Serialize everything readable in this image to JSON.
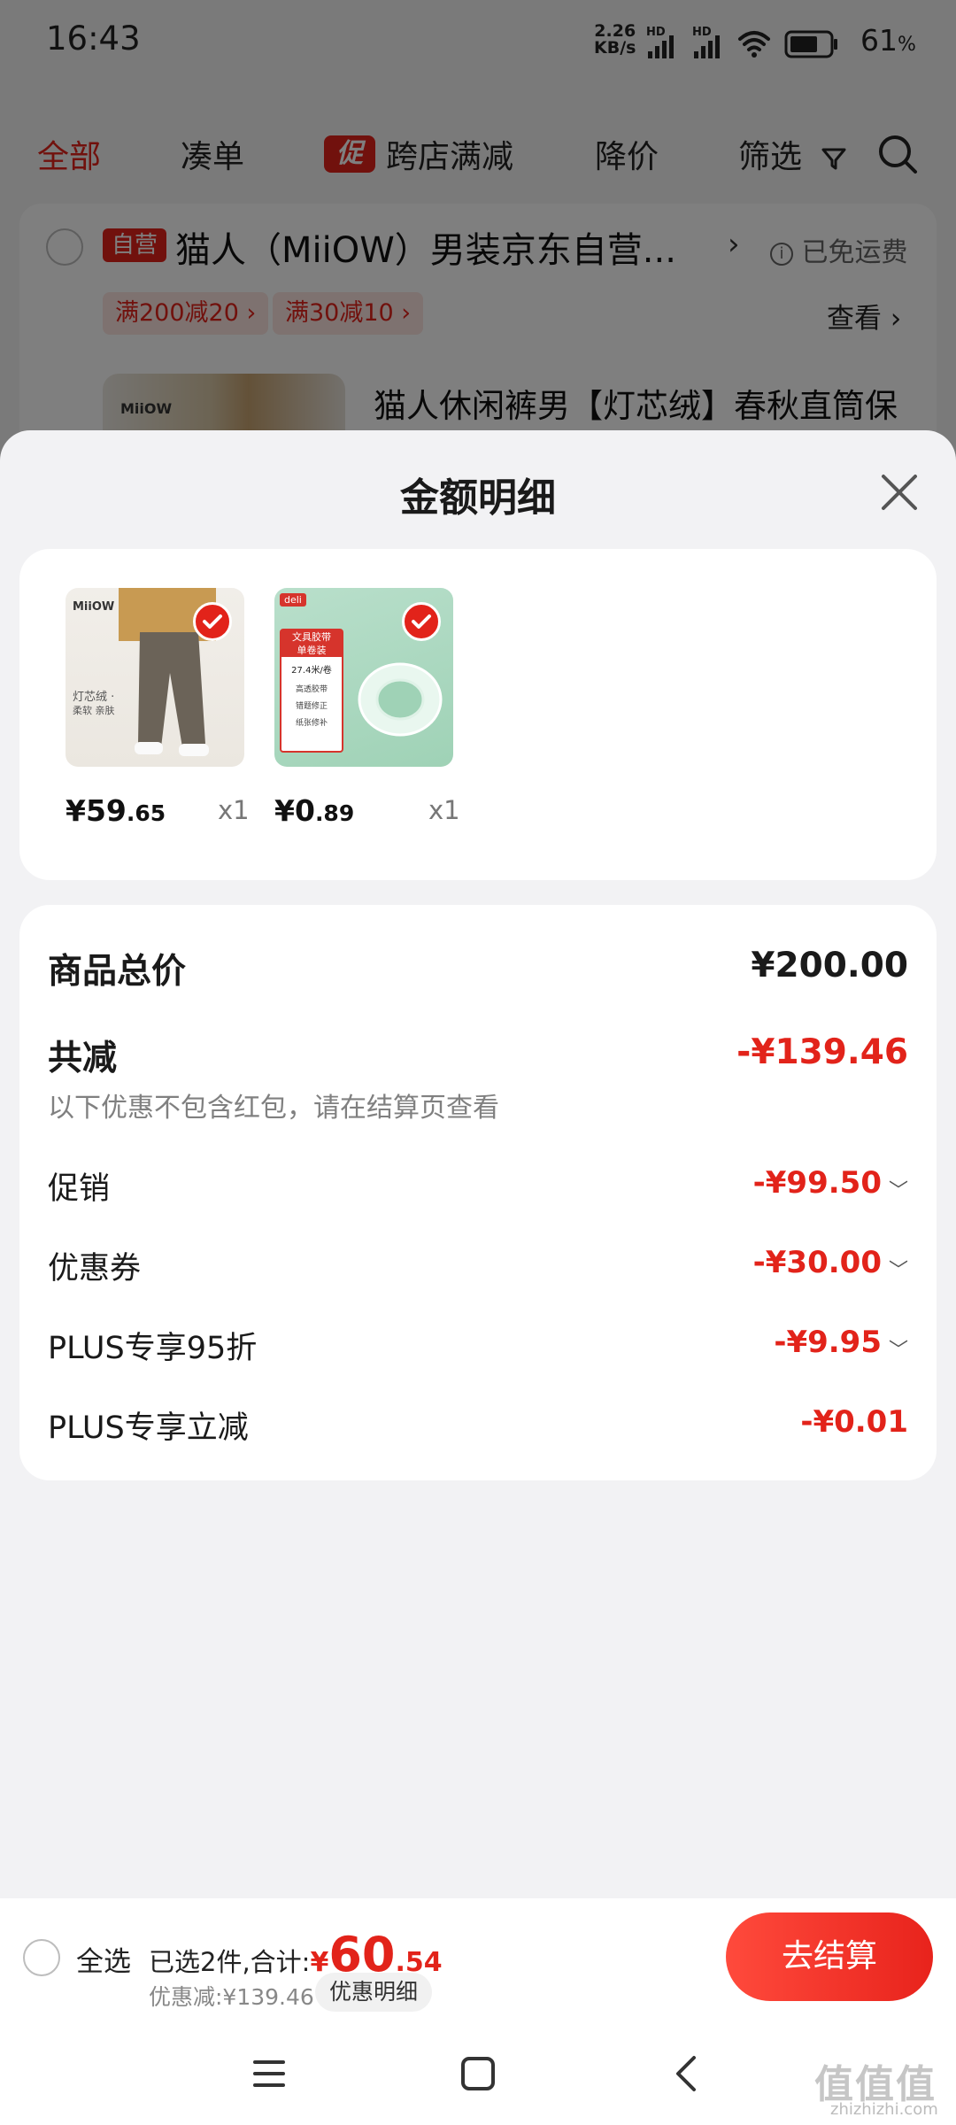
{
  "status_bar": {
    "time": "16:43",
    "net_speed": "2.26",
    "net_unit": "KB/s",
    "battery_pct": "61",
    "battery_unit": "%"
  },
  "tabs": [
    {
      "label": "全部",
      "active": true
    },
    {
      "label": "凑单"
    },
    {
      "label": "跨店满减",
      "badge": "促"
    },
    {
      "label": "降价"
    },
    {
      "label": "筛选"
    }
  ],
  "store": {
    "badge": "自营",
    "name": "猫人（MiiOW）男装京东自营...",
    "shipping": "已免运费",
    "promos": [
      "满200减20 ›",
      "满30减10 ›"
    ],
    "view_label": "查看 ›",
    "product_title": "猫人休闲裤男【灯芯绒】春秋直筒保",
    "thumb_logo": "MiiOW"
  },
  "sheet": {
    "title": "金额明细",
    "products": [
      {
        "price_int": "¥59",
        "price_dec": ".65",
        "qty": "x1",
        "thumb_texts": [
          "MiiOW",
          "灯芯绒 ·",
          "柔软 亲肤"
        ]
      },
      {
        "price_int": "¥0",
        "price_dec": ".89",
        "qty": "x1",
        "thumb_texts": [
          "deli",
          "文具胶带",
          "单卷装",
          "27.4米/卷",
          "高透胶带",
          "错题修正",
          "纸张修补"
        ]
      }
    ],
    "total_label": "商品总价",
    "total_value": "¥200.00",
    "reduction_label": "共减",
    "reduction_value": "-¥139.46",
    "note": "以下优惠不包含红包，请在结算页查看",
    "discounts": [
      {
        "label": "促销",
        "value": "-¥99.50",
        "expandable": true
      },
      {
        "label": "优惠券",
        "value": "-¥30.00",
        "expandable": true
      },
      {
        "label": "PLUS专享95折",
        "value": "-¥9.95",
        "expandable": true
      },
      {
        "label": "PLUS专享立减",
        "value": "-¥0.01",
        "expandable": false
      }
    ]
  },
  "checkout": {
    "select_all": "全选",
    "selected_text": "已选2件,合计:",
    "total_symbol": "¥",
    "total_int": "60",
    "total_dec": ".54",
    "discount_text": "优惠减:¥139.46",
    "discount_detail": "优惠明细",
    "button": "去结算"
  },
  "watermark": {
    "main": "值值值",
    "sub": "zhizhizhi.com"
  },
  "colors": {
    "accent": "#e2231a",
    "badge_bg": "#fde4e1"
  }
}
